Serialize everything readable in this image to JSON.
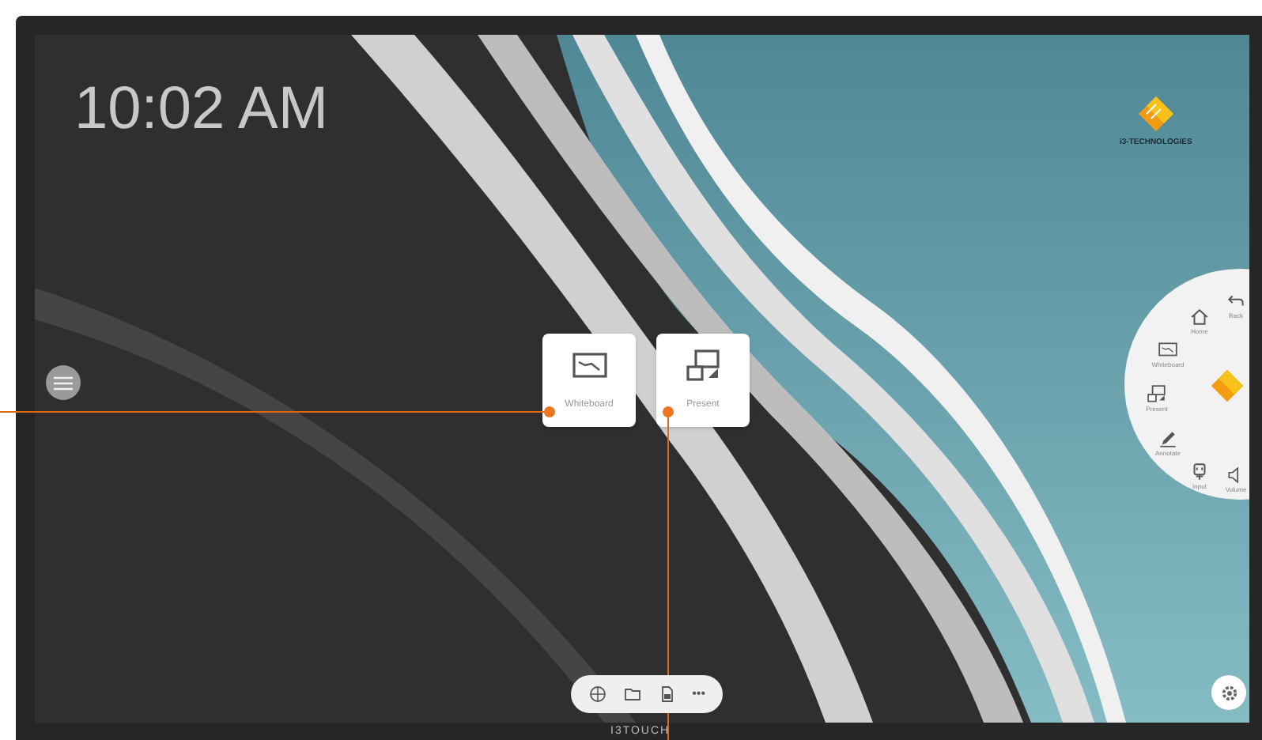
{
  "clock": "10:02 AM",
  "logo": {
    "text": "i3-TECHNOLOGIES"
  },
  "launcher_cards": [
    {
      "label": "Whiteboard",
      "kind": "whiteboard"
    },
    {
      "label": "Present",
      "kind": "present"
    }
  ],
  "radial_menu": {
    "items": [
      {
        "label": "Back",
        "kind": "back"
      },
      {
        "label": "Home",
        "kind": "home"
      },
      {
        "label": "Whiteboard",
        "kind": "whiteboard"
      },
      {
        "label": "Present",
        "kind": "present"
      },
      {
        "label": "Annotate",
        "kind": "annotate"
      },
      {
        "label": "Input",
        "kind": "input"
      },
      {
        "label": "Volume",
        "kind": "volume"
      }
    ]
  },
  "dock": {
    "items": [
      {
        "kind": "globe"
      },
      {
        "kind": "folder"
      },
      {
        "kind": "document"
      },
      {
        "kind": "more",
        "text": "•••"
      }
    ]
  },
  "bezel_brand": "I3TOUCH"
}
